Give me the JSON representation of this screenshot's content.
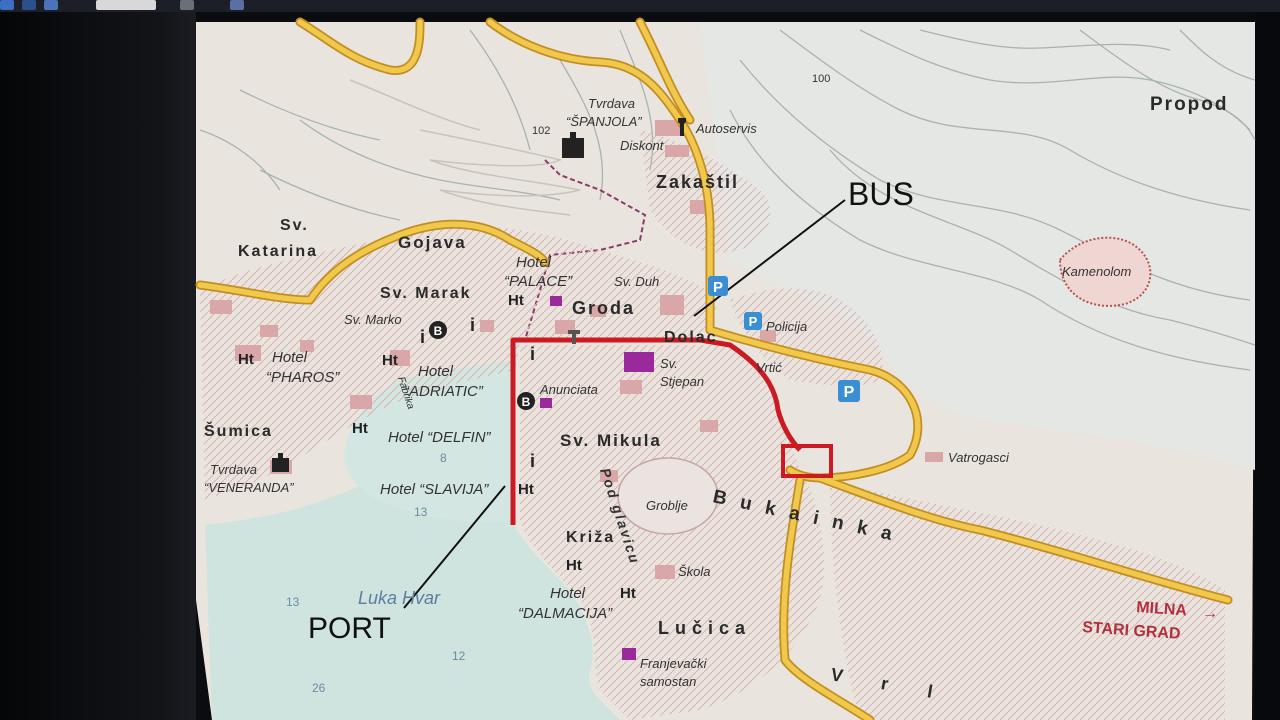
{
  "map": {
    "title_partial": "Propod",
    "districts": {
      "katarina": "Sv. Katarina",
      "gojava": "Gojava",
      "marak": "Sv. Marak",
      "groda": "Groda",
      "zakastil": "Zakaštil",
      "dolac": "Dolac",
      "mikula": "Sv. Mikula",
      "bukainka": "Bukainka",
      "kriza": "Križa",
      "lucica": "Lučica",
      "sumica": "Šumica",
      "vrl": "Vrl"
    },
    "places": {
      "tvrdava_spanjola_1": "Tvrdava",
      "tvrdava_spanjola_2": "“ŠPANJOLA”",
      "tvrdava_veneranda_1": "Tvrdava",
      "tvrdava_veneranda_2": "“VENERANDA”",
      "autoservis": "Autoservis",
      "diskont": "Diskont",
      "hotel_palace_1": "Hotel",
      "hotel_palace_2": "“PALACE”",
      "sv_duh": "Sv. Duh",
      "sv_marko": "Sv. Marko",
      "policija": "Policija",
      "vrtic": "Vrtić",
      "sv_stjepan_1": "Sv.",
      "sv_stjepan_2": "Stjepan",
      "anunciata": "Anunciata",
      "hotel_pharos_1": "Hotel",
      "hotel_pharos_2": "“PHAROS”",
      "hotel_adriatic_1": "Hotel",
      "hotel_adriatic_2": "“ADRIATIC”",
      "hotel_delfin": "Hotel “DELFIN”",
      "hotel_slavija": "Hotel “SLAVIJA”",
      "hotel_dalmacija_1": "Hotel",
      "hotel_dalmacija_2": "“DALMACIJA”",
      "groblje": "Groblje",
      "skola": "Škola",
      "vatrogasci": "Vatrogasci",
      "kamenolom": "Kamenolom",
      "luka_hvar": "Luka Hvar",
      "franjevacki_1": "Franjevački",
      "franjevacki_2": "samostan",
      "pod_glavicu": "Pod glavicu",
      "fabrika": "Fabrika"
    },
    "elevations": {
      "e102": "102",
      "e100": "100"
    },
    "depths": {
      "d8": "8",
      "d13a": "13",
      "d13b": "13",
      "d12": "12",
      "d26": "26"
    },
    "signs": {
      "milna": "MILNA",
      "stari_grad": "STARI GRAD",
      "arrow": "→"
    },
    "symbols": {
      "hotel": "Ht",
      "bus": "B",
      "info": "i",
      "parking": "P",
      "wrench": "🔧"
    },
    "annotations": {
      "bus": "BUS",
      "port": "PORT"
    },
    "colors": {
      "sea": "#cfe3df",
      "land": "#e8e4dc",
      "road_yellow": "#e6b93a",
      "route_red": "#cc1a22",
      "contour": "#a9b3ae",
      "building": "#d9a7a7",
      "parking_blue": "#3a8fd4",
      "church_purple": "#9a2a9c"
    }
  }
}
